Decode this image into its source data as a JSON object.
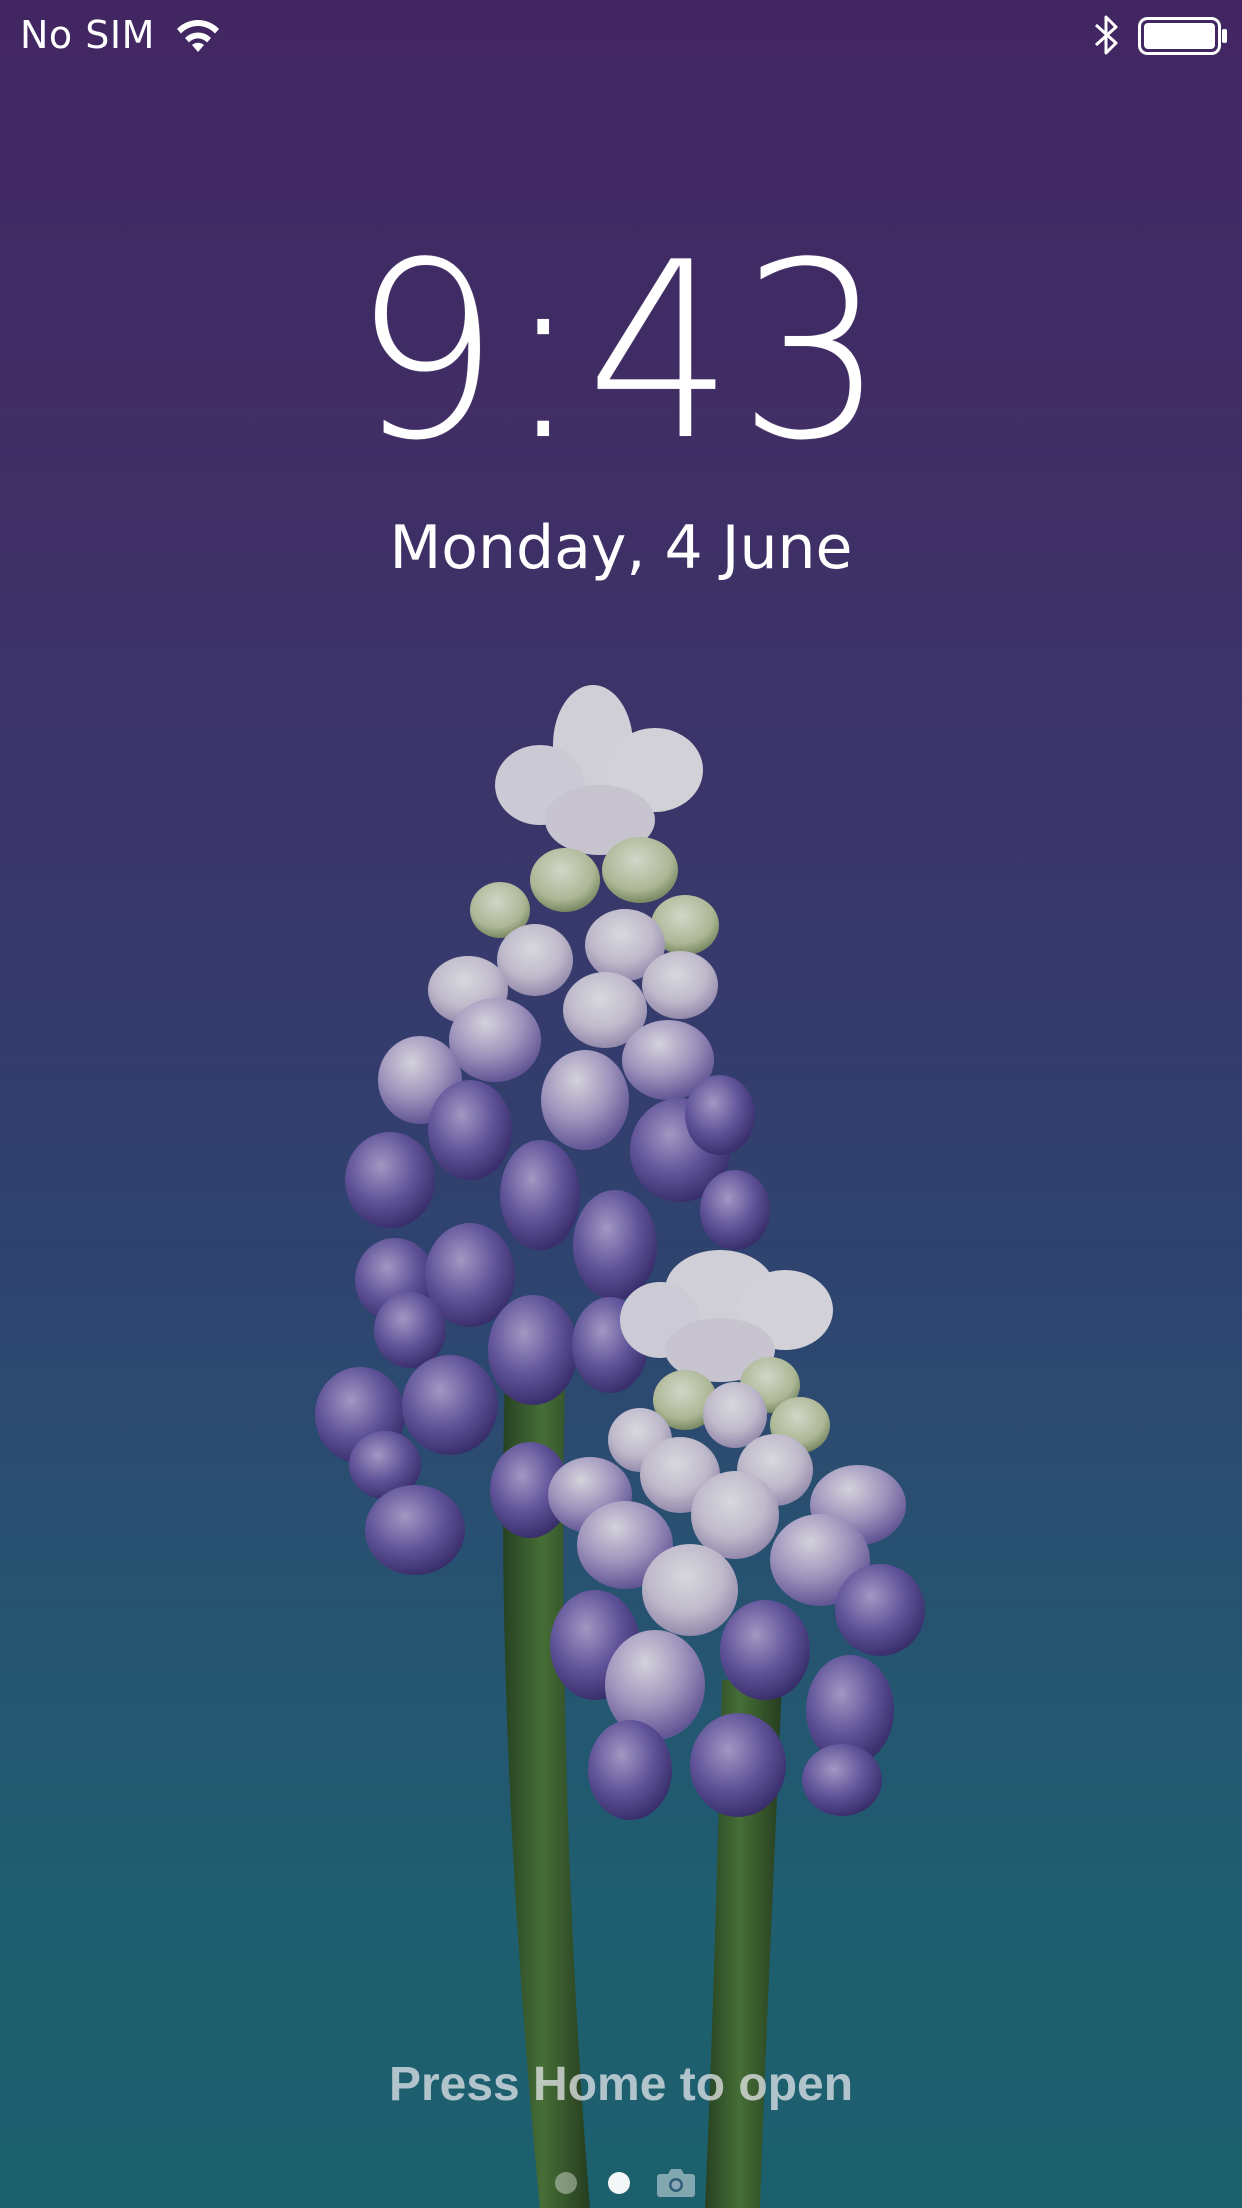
{
  "status_bar": {
    "carrier": "No SIM",
    "wifi_icon": "wifi-icon",
    "bluetooth_icon": "bluetooth-icon",
    "battery_icon": "battery-icon",
    "battery_level": 1.0
  },
  "lock_screen": {
    "time": "9:43",
    "date": "Monday, 4 June",
    "unlock_hint": "Press Home to open"
  },
  "page_indicator": {
    "pages": 2,
    "current_page": 2,
    "trailing_icon": "camera-icon"
  },
  "wallpaper": {
    "subject": "grape hyacinth flowers",
    "colors": {
      "top": "#4a2b6c",
      "middle": "#364a7a",
      "bottom": "#1f6d78",
      "petal_white": "#e9e6ef",
      "petal_purple": "#6a5aa8",
      "stem": "#3f6b30"
    }
  }
}
